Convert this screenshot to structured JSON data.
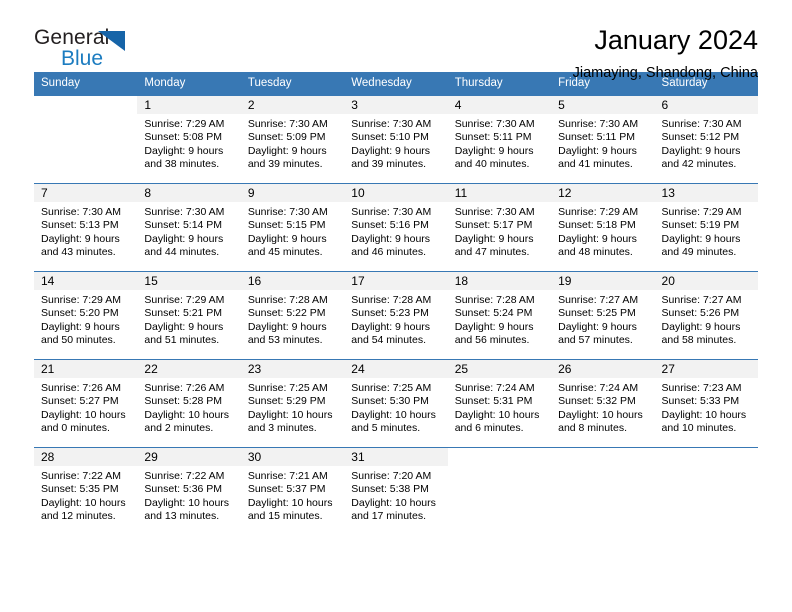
{
  "brand": {
    "name_part1": "General",
    "name_part2": "Blue"
  },
  "header": {
    "title": "January 2024",
    "location": "Jiamaying, Shandong, China"
  },
  "calendar": {
    "weekday_headers": [
      "Sunday",
      "Monday",
      "Tuesday",
      "Wednesday",
      "Thursday",
      "Friday",
      "Saturday"
    ],
    "accent_color": "#3878b4",
    "daynum_band_color": "#f2f2f2",
    "labels": {
      "sunrise_prefix": "Sunrise:",
      "sunset_prefix": "Sunset:",
      "daylight_prefix": "Daylight:"
    },
    "weeks": [
      [
        {
          "day": "",
          "sunrise": "",
          "sunset": "",
          "daylight_line1": "",
          "daylight_line2": ""
        },
        {
          "day": "1",
          "sunrise": "Sunrise: 7:29 AM",
          "sunset": "Sunset: 5:08 PM",
          "daylight_line1": "Daylight: 9 hours",
          "daylight_line2": "and 38 minutes."
        },
        {
          "day": "2",
          "sunrise": "Sunrise: 7:30 AM",
          "sunset": "Sunset: 5:09 PM",
          "daylight_line1": "Daylight: 9 hours",
          "daylight_line2": "and 39 minutes."
        },
        {
          "day": "3",
          "sunrise": "Sunrise: 7:30 AM",
          "sunset": "Sunset: 5:10 PM",
          "daylight_line1": "Daylight: 9 hours",
          "daylight_line2": "and 39 minutes."
        },
        {
          "day": "4",
          "sunrise": "Sunrise: 7:30 AM",
          "sunset": "Sunset: 5:11 PM",
          "daylight_line1": "Daylight: 9 hours",
          "daylight_line2": "and 40 minutes."
        },
        {
          "day": "5",
          "sunrise": "Sunrise: 7:30 AM",
          "sunset": "Sunset: 5:11 PM",
          "daylight_line1": "Daylight: 9 hours",
          "daylight_line2": "and 41 minutes."
        },
        {
          "day": "6",
          "sunrise": "Sunrise: 7:30 AM",
          "sunset": "Sunset: 5:12 PM",
          "daylight_line1": "Daylight: 9 hours",
          "daylight_line2": "and 42 minutes."
        }
      ],
      [
        {
          "day": "7",
          "sunrise": "Sunrise: 7:30 AM",
          "sunset": "Sunset: 5:13 PM",
          "daylight_line1": "Daylight: 9 hours",
          "daylight_line2": "and 43 minutes."
        },
        {
          "day": "8",
          "sunrise": "Sunrise: 7:30 AM",
          "sunset": "Sunset: 5:14 PM",
          "daylight_line1": "Daylight: 9 hours",
          "daylight_line2": "and 44 minutes."
        },
        {
          "day": "9",
          "sunrise": "Sunrise: 7:30 AM",
          "sunset": "Sunset: 5:15 PM",
          "daylight_line1": "Daylight: 9 hours",
          "daylight_line2": "and 45 minutes."
        },
        {
          "day": "10",
          "sunrise": "Sunrise: 7:30 AM",
          "sunset": "Sunset: 5:16 PM",
          "daylight_line1": "Daylight: 9 hours",
          "daylight_line2": "and 46 minutes."
        },
        {
          "day": "11",
          "sunrise": "Sunrise: 7:30 AM",
          "sunset": "Sunset: 5:17 PM",
          "daylight_line1": "Daylight: 9 hours",
          "daylight_line2": "and 47 minutes."
        },
        {
          "day": "12",
          "sunrise": "Sunrise: 7:29 AM",
          "sunset": "Sunset: 5:18 PM",
          "daylight_line1": "Daylight: 9 hours",
          "daylight_line2": "and 48 minutes."
        },
        {
          "day": "13",
          "sunrise": "Sunrise: 7:29 AM",
          "sunset": "Sunset: 5:19 PM",
          "daylight_line1": "Daylight: 9 hours",
          "daylight_line2": "and 49 minutes."
        }
      ],
      [
        {
          "day": "14",
          "sunrise": "Sunrise: 7:29 AM",
          "sunset": "Sunset: 5:20 PM",
          "daylight_line1": "Daylight: 9 hours",
          "daylight_line2": "and 50 minutes."
        },
        {
          "day": "15",
          "sunrise": "Sunrise: 7:29 AM",
          "sunset": "Sunset: 5:21 PM",
          "daylight_line1": "Daylight: 9 hours",
          "daylight_line2": "and 51 minutes."
        },
        {
          "day": "16",
          "sunrise": "Sunrise: 7:28 AM",
          "sunset": "Sunset: 5:22 PM",
          "daylight_line1": "Daylight: 9 hours",
          "daylight_line2": "and 53 minutes."
        },
        {
          "day": "17",
          "sunrise": "Sunrise: 7:28 AM",
          "sunset": "Sunset: 5:23 PM",
          "daylight_line1": "Daylight: 9 hours",
          "daylight_line2": "and 54 minutes."
        },
        {
          "day": "18",
          "sunrise": "Sunrise: 7:28 AM",
          "sunset": "Sunset: 5:24 PM",
          "daylight_line1": "Daylight: 9 hours",
          "daylight_line2": "and 56 minutes."
        },
        {
          "day": "19",
          "sunrise": "Sunrise: 7:27 AM",
          "sunset": "Sunset: 5:25 PM",
          "daylight_line1": "Daylight: 9 hours",
          "daylight_line2": "and 57 minutes."
        },
        {
          "day": "20",
          "sunrise": "Sunrise: 7:27 AM",
          "sunset": "Sunset: 5:26 PM",
          "daylight_line1": "Daylight: 9 hours",
          "daylight_line2": "and 58 minutes."
        }
      ],
      [
        {
          "day": "21",
          "sunrise": "Sunrise: 7:26 AM",
          "sunset": "Sunset: 5:27 PM",
          "daylight_line1": "Daylight: 10 hours",
          "daylight_line2": "and 0 minutes."
        },
        {
          "day": "22",
          "sunrise": "Sunrise: 7:26 AM",
          "sunset": "Sunset: 5:28 PM",
          "daylight_line1": "Daylight: 10 hours",
          "daylight_line2": "and 2 minutes."
        },
        {
          "day": "23",
          "sunrise": "Sunrise: 7:25 AM",
          "sunset": "Sunset: 5:29 PM",
          "daylight_line1": "Daylight: 10 hours",
          "daylight_line2": "and 3 minutes."
        },
        {
          "day": "24",
          "sunrise": "Sunrise: 7:25 AM",
          "sunset": "Sunset: 5:30 PM",
          "daylight_line1": "Daylight: 10 hours",
          "daylight_line2": "and 5 minutes."
        },
        {
          "day": "25",
          "sunrise": "Sunrise: 7:24 AM",
          "sunset": "Sunset: 5:31 PM",
          "daylight_line1": "Daylight: 10 hours",
          "daylight_line2": "and 6 minutes."
        },
        {
          "day": "26",
          "sunrise": "Sunrise: 7:24 AM",
          "sunset": "Sunset: 5:32 PM",
          "daylight_line1": "Daylight: 10 hours",
          "daylight_line2": "and 8 minutes."
        },
        {
          "day": "27",
          "sunrise": "Sunrise: 7:23 AM",
          "sunset": "Sunset: 5:33 PM",
          "daylight_line1": "Daylight: 10 hours",
          "daylight_line2": "and 10 minutes."
        }
      ],
      [
        {
          "day": "28",
          "sunrise": "Sunrise: 7:22 AM",
          "sunset": "Sunset: 5:35 PM",
          "daylight_line1": "Daylight: 10 hours",
          "daylight_line2": "and 12 minutes."
        },
        {
          "day": "29",
          "sunrise": "Sunrise: 7:22 AM",
          "sunset": "Sunset: 5:36 PM",
          "daylight_line1": "Daylight: 10 hours",
          "daylight_line2": "and 13 minutes."
        },
        {
          "day": "30",
          "sunrise": "Sunrise: 7:21 AM",
          "sunset": "Sunset: 5:37 PM",
          "daylight_line1": "Daylight: 10 hours",
          "daylight_line2": "and 15 minutes."
        },
        {
          "day": "31",
          "sunrise": "Sunrise: 7:20 AM",
          "sunset": "Sunset: 5:38 PM",
          "daylight_line1": "Daylight: 10 hours",
          "daylight_line2": "and 17 minutes."
        },
        {
          "day": "",
          "sunrise": "",
          "sunset": "",
          "daylight_line1": "",
          "daylight_line2": ""
        },
        {
          "day": "",
          "sunrise": "",
          "sunset": "",
          "daylight_line1": "",
          "daylight_line2": ""
        },
        {
          "day": "",
          "sunrise": "",
          "sunset": "",
          "daylight_line1": "",
          "daylight_line2": ""
        }
      ]
    ]
  }
}
